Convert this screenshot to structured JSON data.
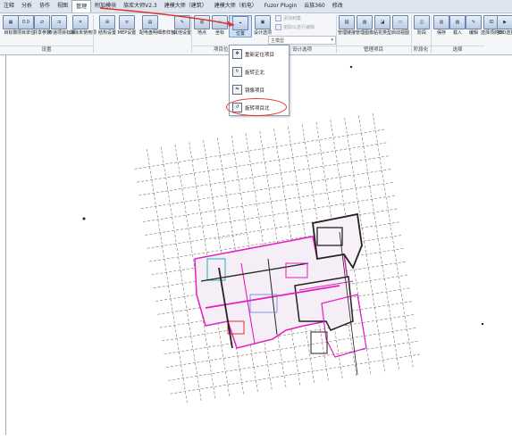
{
  "menubar": {
    "tabs": [
      "注释",
      "分析",
      "协作",
      "视图",
      "管理",
      "附加模块",
      "族库大师V2.3",
      "建模大师（建筑）",
      "建模大师（机电）",
      "Fuzor Plugin",
      "云族360",
      "修改"
    ],
    "active_tab": "管理"
  },
  "ribbon": {
    "tools": {
      "item_params": "目标数",
      "project_units": "项目单位",
      "shared_params": "共享参数",
      "transfer_standards": "传递项目标准",
      "purge": "清除未使用项",
      "struct_settings": "结构设置",
      "mep_settings": "MEP设置",
      "panel_schedule": "配电盘明细表样板",
      "other_settings": "其他设置",
      "location": "地点",
      "coordinates": "坐标",
      "position": "位置",
      "design_options": "设计选项",
      "manage_links": "管理链接",
      "manage_images": "管理图像",
      "decal_types": "贴花类型",
      "startup_view": "启动视图",
      "phasing": "阶段",
      "select_save": "保存",
      "select_load": "载入",
      "select_edit": "编辑",
      "select_by_id": "选择项的ID",
      "id_select": "按ID选择"
    },
    "small": {
      "add_to_set": "添加到集",
      "pick_to_edit": "拾取以进行编辑",
      "main_model": "主模型"
    },
    "groups": {
      "settings": "设置",
      "project_location": "项目位置",
      "design_options": "设计选项",
      "manage_project": "管理项目",
      "phasing": "阶段化",
      "selection": "选择"
    }
  },
  "dropdown": {
    "items": [
      "重新定位项目",
      "旋转正北",
      "镜像项目",
      "旋转项目北"
    ]
  },
  "colors": {
    "highlight": "#e03030",
    "arrow": "#e03030",
    "grid_line": "#8a6a6a",
    "drawing_magenta": "#e020c0"
  }
}
